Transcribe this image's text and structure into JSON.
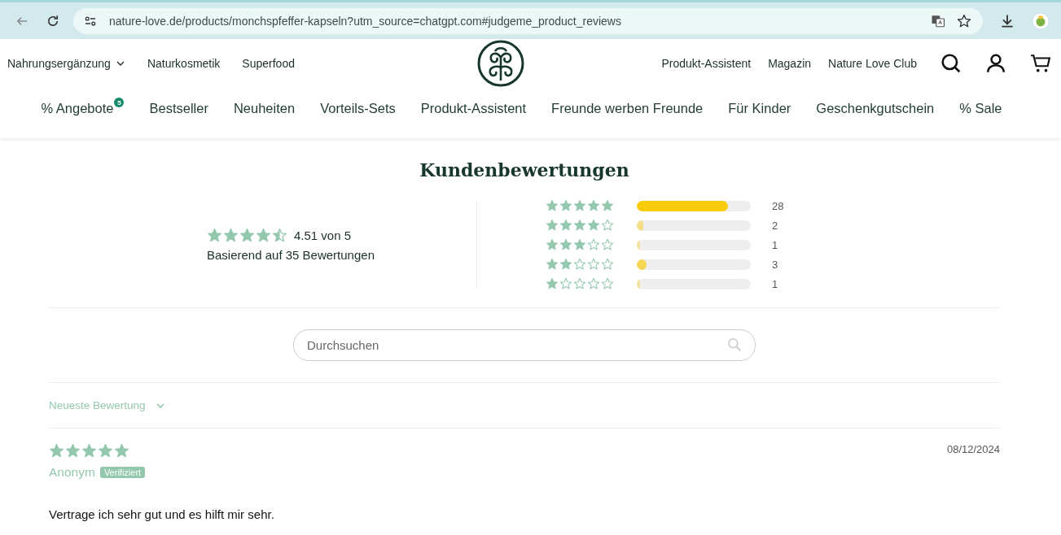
{
  "browser": {
    "url": "nature-love.de/products/monchspfeffer-kapseln?utm_source=chatgpt.com#judgeme_product_reviews",
    "back_disabled": true
  },
  "top_links_left": [
    {
      "label": "Nahrungsergänzung",
      "dropdown": true
    },
    {
      "label": "Naturkosmetik",
      "dropdown": false
    },
    {
      "label": "Superfood",
      "dropdown": false
    }
  ],
  "top_links_right": [
    "Produkt-Assistent",
    "Magazin",
    "Nature Love Club"
  ],
  "main_nav": [
    {
      "label": "% Angebote",
      "badge": "5"
    },
    {
      "label": "Bestseller"
    },
    {
      "label": "Neuheiten"
    },
    {
      "label": "Vorteils-Sets"
    },
    {
      "label": "Produkt-Assistent"
    },
    {
      "label": "Freunde werben Freunde"
    },
    {
      "label": "Für Kinder"
    },
    {
      "label": "Geschenkgutschein"
    },
    {
      "label": "% Sale"
    }
  ],
  "reviews": {
    "title": "Kundenbewertungen",
    "summary": {
      "stars": 4.5,
      "average": "4.51 von 5",
      "based_on": "Basierend auf 35 Bewertungen"
    },
    "histogram": [
      {
        "stars": 5,
        "level": 0.8,
        "count": "28"
      },
      {
        "stars": 4,
        "level": 0.057,
        "count": "2"
      },
      {
        "stars": 3,
        "level": 0.029,
        "count": "1"
      },
      {
        "stars": 2,
        "level": 0.086,
        "count": "3"
      },
      {
        "stars": 1,
        "level": 0.029,
        "count": "1"
      }
    ],
    "search": {
      "placeholder": "Durchsuchen"
    },
    "sort": {
      "value": "Neueste Bewertung"
    },
    "items": [
      {
        "stars": 5,
        "date": "08/12/2024",
        "author": "Anonym",
        "verified": true,
        "badge": "Verifiziert",
        "text": "Vertrage ich sehr gut und es hilft mir sehr."
      }
    ]
  }
}
